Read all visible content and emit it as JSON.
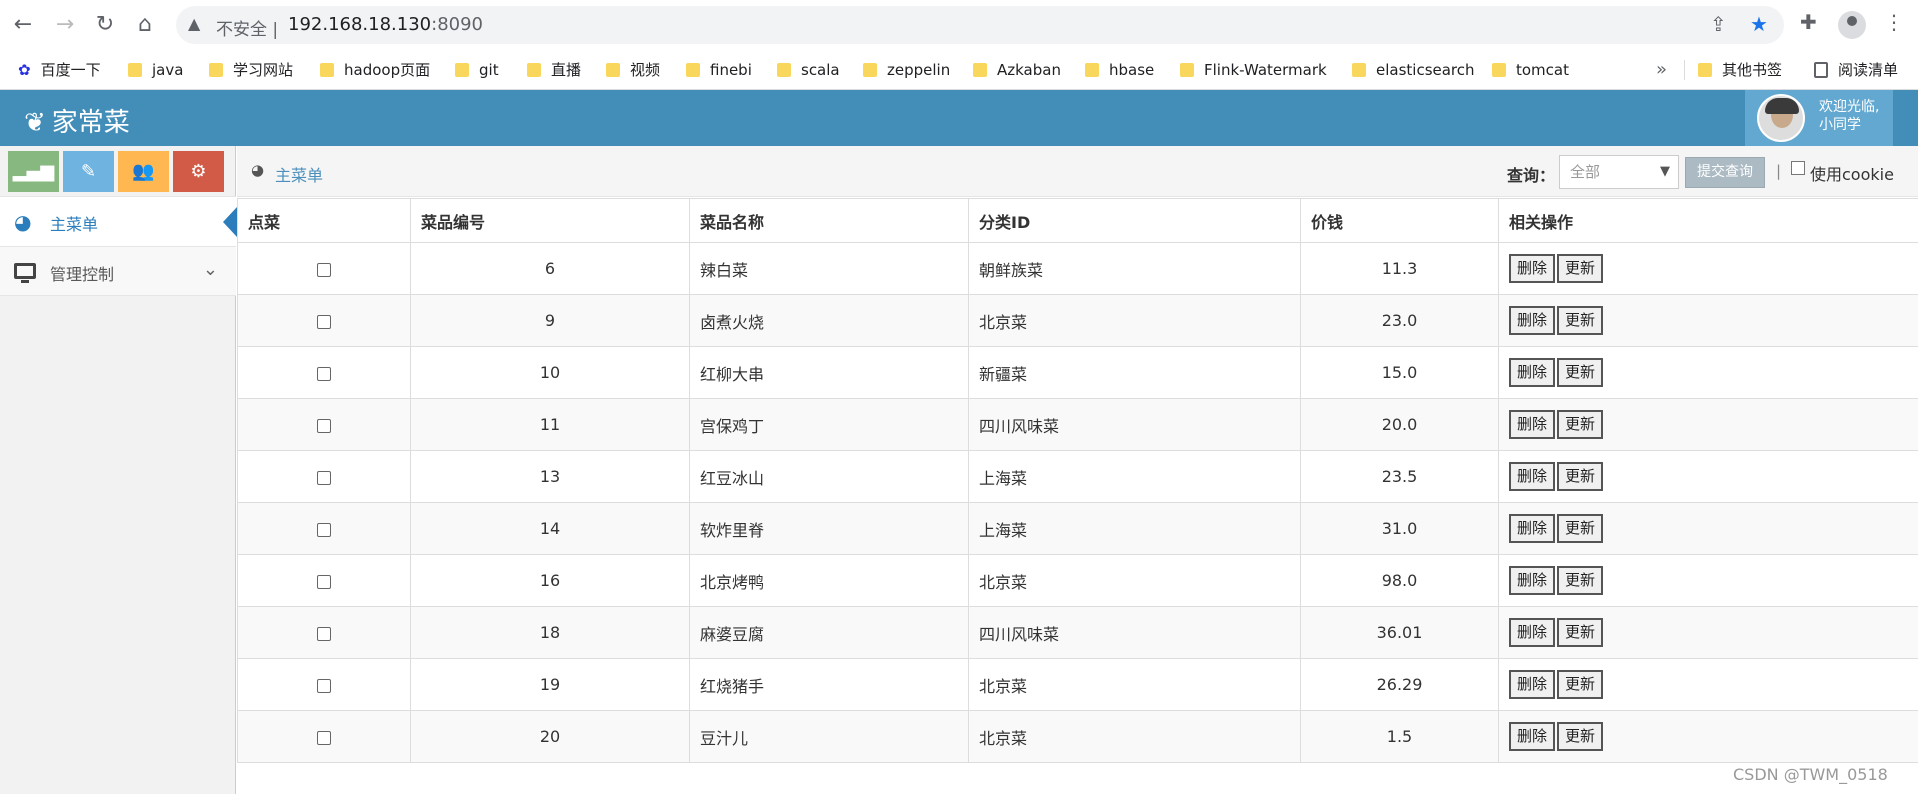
{
  "browser": {
    "insecure_label": "不安全",
    "host": "192.168.18.130",
    "port": ":8090",
    "bookmarks": [
      "百度一下",
      "java",
      "学习网站",
      "hadoop页面",
      "git",
      "直播",
      "视频",
      "finebi",
      "scala",
      "zeppelin",
      "Azkaban",
      "hbase",
      "Flink-Watermark",
      "elasticsearch",
      "tomcat"
    ],
    "more": "»",
    "other_bookmarks": "其他书签",
    "reading_list": "阅读清单"
  },
  "app": {
    "brand": "家常菜",
    "welcome_line1": "欢迎光临,",
    "welcome_line2": "小同学",
    "header_color": "#438eb9"
  },
  "sidebar": {
    "items": [
      {
        "label": "主菜单",
        "icon": "dashboard-icon",
        "active": true
      },
      {
        "label": "管理控制",
        "icon": "desktop-icon",
        "active": false
      }
    ]
  },
  "breadcrumb": {
    "label": "主菜单"
  },
  "query": {
    "label": "查询：",
    "selected": "全部",
    "submit_label": "提交查询",
    "separator": "|",
    "cookie_label": "使用cookie"
  },
  "table": {
    "headers": [
      "点菜",
      "菜品编号",
      "菜品名称",
      "分类ID",
      "价钱",
      "相关操作"
    ],
    "action_delete": "删除",
    "action_update": "更新",
    "rows": [
      {
        "id": "6",
        "name": "辣白菜",
        "category": "朝鲜族菜",
        "price": "11.3"
      },
      {
        "id": "9",
        "name": "卤煮火烧",
        "category": "北京菜",
        "price": "23.0"
      },
      {
        "id": "10",
        "name": "红柳大串",
        "category": "新疆菜",
        "price": "15.0"
      },
      {
        "id": "11",
        "name": "宫保鸡丁",
        "category": "四川风味菜",
        "price": "20.0"
      },
      {
        "id": "13",
        "name": "红豆冰山",
        "category": "上海菜",
        "price": "23.5"
      },
      {
        "id": "14",
        "name": "软炸里脊",
        "category": "上海菜",
        "price": "31.0"
      },
      {
        "id": "16",
        "name": "北京烤鸭",
        "category": "北京菜",
        "price": "98.0"
      },
      {
        "id": "18",
        "name": "麻婆豆腐",
        "category": "四川风味菜",
        "price": "36.01"
      },
      {
        "id": "19",
        "name": "红烧猪手",
        "category": "北京菜",
        "price": "26.29"
      },
      {
        "id": "20",
        "name": "豆汁儿",
        "category": "北京菜",
        "price": "1.5"
      }
    ]
  },
  "watermark": "CSDN @TWM_0518"
}
